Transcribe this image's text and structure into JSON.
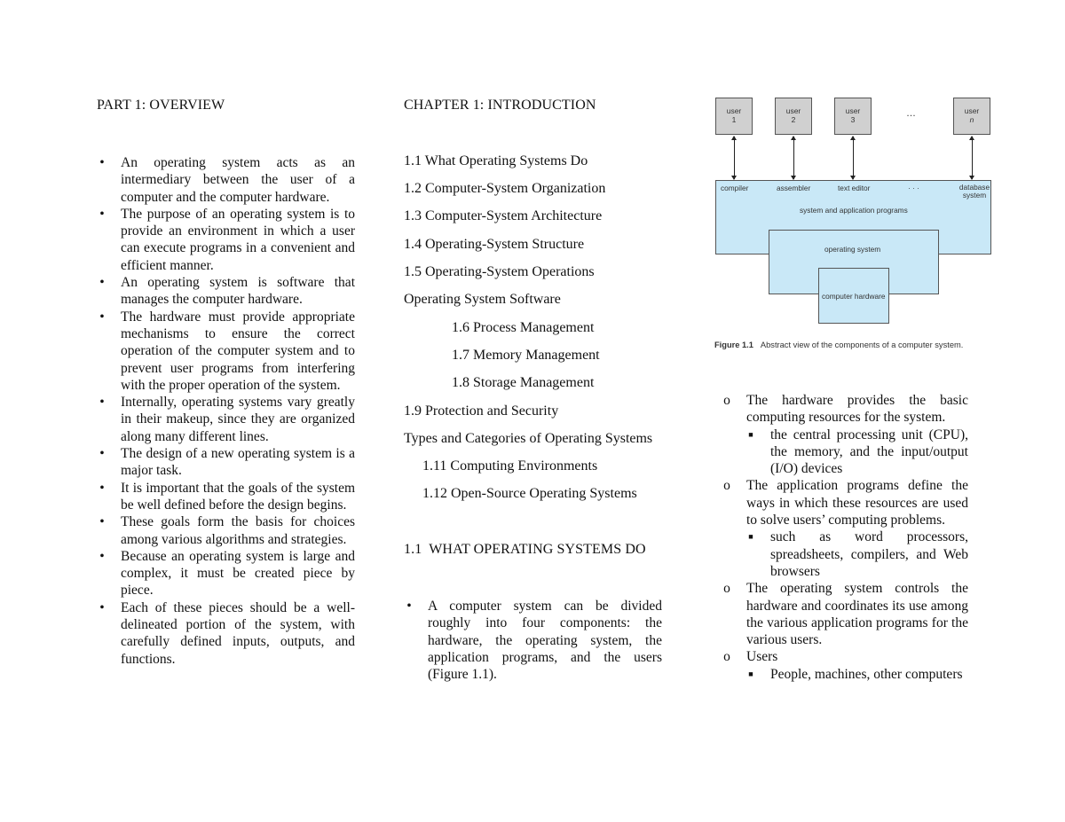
{
  "left": {
    "heading": "PART 1: OVERVIEW",
    "bullets": [
      "An operating system acts as an intermediary between the user of a computer and the computer hardware.",
      "The purpose of an operating system is to provide an environment in which a user can execute programs in a convenient and efficient manner.",
      "An operating system is software that manages the computer hardware.",
      "The hardware must provide appropriate mechanisms to ensure the correct operation of the computer system and to prevent user programs from interfering with the proper operation of the system.",
      "Internally, operating systems vary greatly in their makeup, since they are organized along many different lines.",
      "The design of a new operating system is a major task.",
      "It is important that the goals of the system be well defined before the design begins.",
      "These goals form the basis for choices among various algorithms and strategies.",
      "Because an operating system is large and complex, it must be created piece by piece.",
      "Each of these pieces should be a well-delineated portion of the system, with carefully defined inputs, outputs, and functions."
    ],
    "bullet_icon": "•"
  },
  "middle": {
    "heading": "CHAPTER 1: INTRODUCTION",
    "toc": [
      "1.1 What Operating Systems Do",
      "1.2 Computer-System Organization",
      "1.3 Computer-System Architecture",
      "1.4 Operating-System Structure",
      "1.5 Operating-System Operations",
      "Operating System Software",
      "1.6 Process Management",
      "1.7 Memory Management",
      "1.8 Storage Management",
      "1.9 Protection and Security",
      "Types and Categories of Operating Systems",
      "1.11 Computing Environments",
      "1.12 Open-Source Operating Systems"
    ],
    "section_heading": "1.1  WHAT OPERATING SYSTEMS DO",
    "bullet": "A computer system can be divided roughly into four components: the hardware, the operating system, the application programs, and the users (Figure 1.1).",
    "bullet_icon": "•"
  },
  "figure": {
    "users": [
      {
        "line1": "user",
        "line2": "1"
      },
      {
        "line1": "user",
        "line2": "2"
      },
      {
        "line1": "user",
        "line2": "3"
      },
      {
        "line1": "user",
        "line2": "n"
      }
    ],
    "ellipsis": "…",
    "programs": [
      "compiler",
      "assembler",
      "text editor",
      "database system"
    ],
    "programs_ellipsis": "· · ·",
    "layer_apps": "system and application programs",
    "layer_os": "operating system",
    "layer_hw": "computer hardware",
    "caption_label": "Figure 1.1",
    "caption_text": "Abstract view of the components of a computer system.",
    "colors": {
      "user_box": "#d0d0d0",
      "layer_box": "#c9e8f7"
    }
  },
  "right": {
    "items": [
      {
        "text": "The hardware provides the basic computing resources for the system.",
        "sub": [
          "the central processing unit (CPU), the memory, and the input/output (I/O) devices"
        ]
      },
      {
        "text": "The application programs define the ways in which these resources are used to solve users’ computing problems.",
        "sub": [
          "such as word processors, spreadsheets, compilers, and Web browsers"
        ]
      },
      {
        "text": "The operating system controls the hardware and coordinates its use among the various application programs for the various users.",
        "sub": []
      },
      {
        "text": "Users",
        "sub": [
          "People, machines, other computers"
        ]
      }
    ],
    "item_icon": "o",
    "sub_icon": "■"
  }
}
